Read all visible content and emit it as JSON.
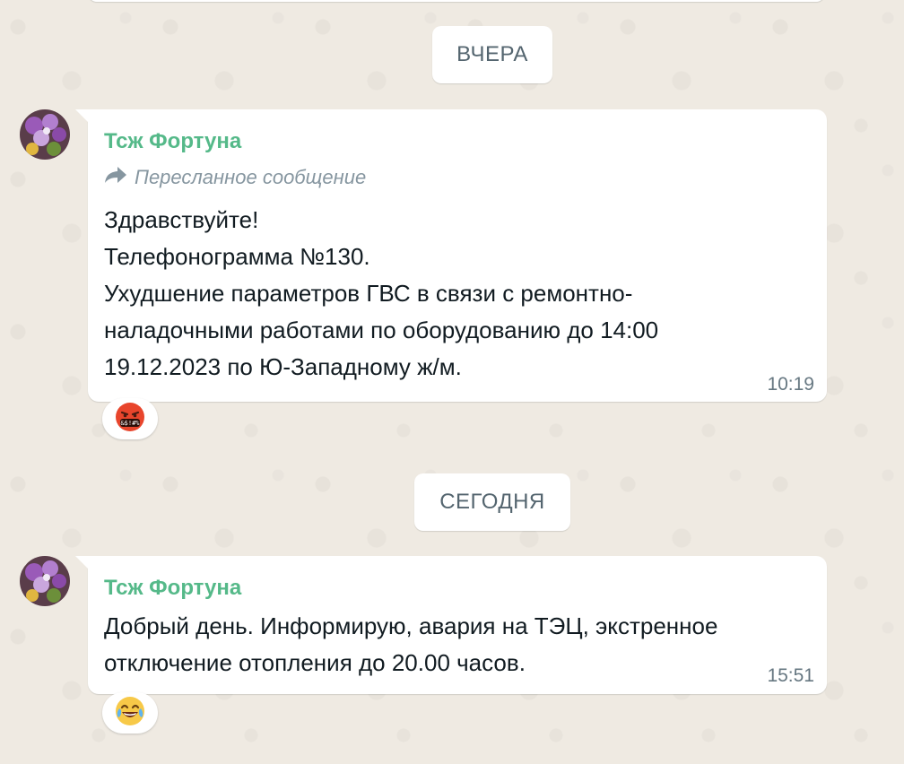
{
  "date_separators": {
    "yesterday": "ВЧЕРА",
    "today": "СЕГОДНЯ"
  },
  "messages": [
    {
      "sender": "Тсж Фортуна",
      "forwarded_label": "Пересланное сообщение",
      "lines": [
        "Здравствуйте!",
        "Телефонограмма №130.",
        "Ухудшение параметров ГВС в связи с ремонтно-",
        "наладочными работами по оборудованию до 14:00",
        "19.12.2023 по Ю-Западному ж/м."
      ],
      "time": "10:19",
      "reaction": "face-with-symbols-on-mouth",
      "reaction_symbols": "&$!#%"
    },
    {
      "sender": "Тсж Фортуна",
      "lines": [
        "Добрый день. Информирую, авария на ТЭЦ, экстренное",
        "отключение отопления до 20.00 часов."
      ],
      "time": "15:51",
      "reaction": "face-with-tears-of-joy"
    }
  ],
  "colors": {
    "background": "#efeae2",
    "bubble": "#ffffff",
    "sender_name": "#55b989",
    "meta_text": "#667781",
    "forwarded_text": "#8696a0"
  }
}
